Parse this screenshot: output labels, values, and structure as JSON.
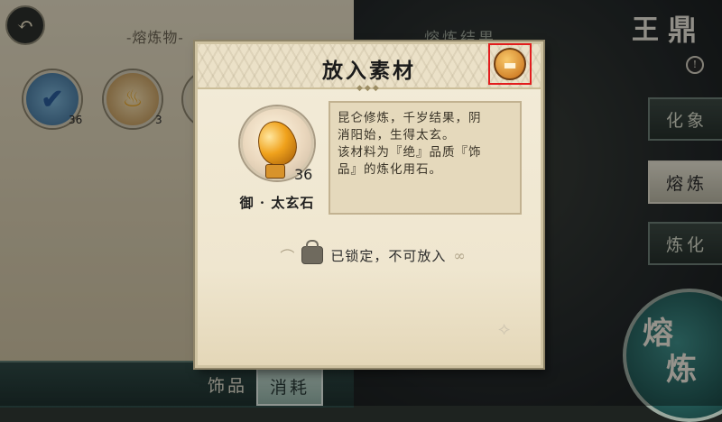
{
  "background": {
    "left_panel_title": "-熔炼物-",
    "right_panel_title": "熔炼结果",
    "brand_text": [
      "王",
      "鼎"
    ],
    "info_mark": "!",
    "slots": [
      {
        "icon": "check-icon",
        "count": "36"
      },
      {
        "icon": "flame-icon",
        "count": "3"
      },
      {
        "icon": "blank",
        "count": ""
      }
    ],
    "side_tabs": [
      "化象",
      "熔炼",
      "炼化"
    ],
    "big_button": [
      "熔",
      "炼"
    ],
    "bottom_tabs": [
      "饰品",
      "消耗"
    ]
  },
  "dialog": {
    "title": "放入素材",
    "item": {
      "name": "御 · 太玄石",
      "count": "36"
    },
    "description_lines": [
      "昆仑修炼，千岁结果，阴",
      "消阳始，生得太玄。",
      "该材料为『绝』品质『饰",
      "品』的炼化用石。"
    ],
    "lock_status": "已锁定，不可放入"
  },
  "colors": {
    "highlight_box": "#e21d1d",
    "parchment": "#f3ecd9",
    "gem": "#f0a21c"
  }
}
